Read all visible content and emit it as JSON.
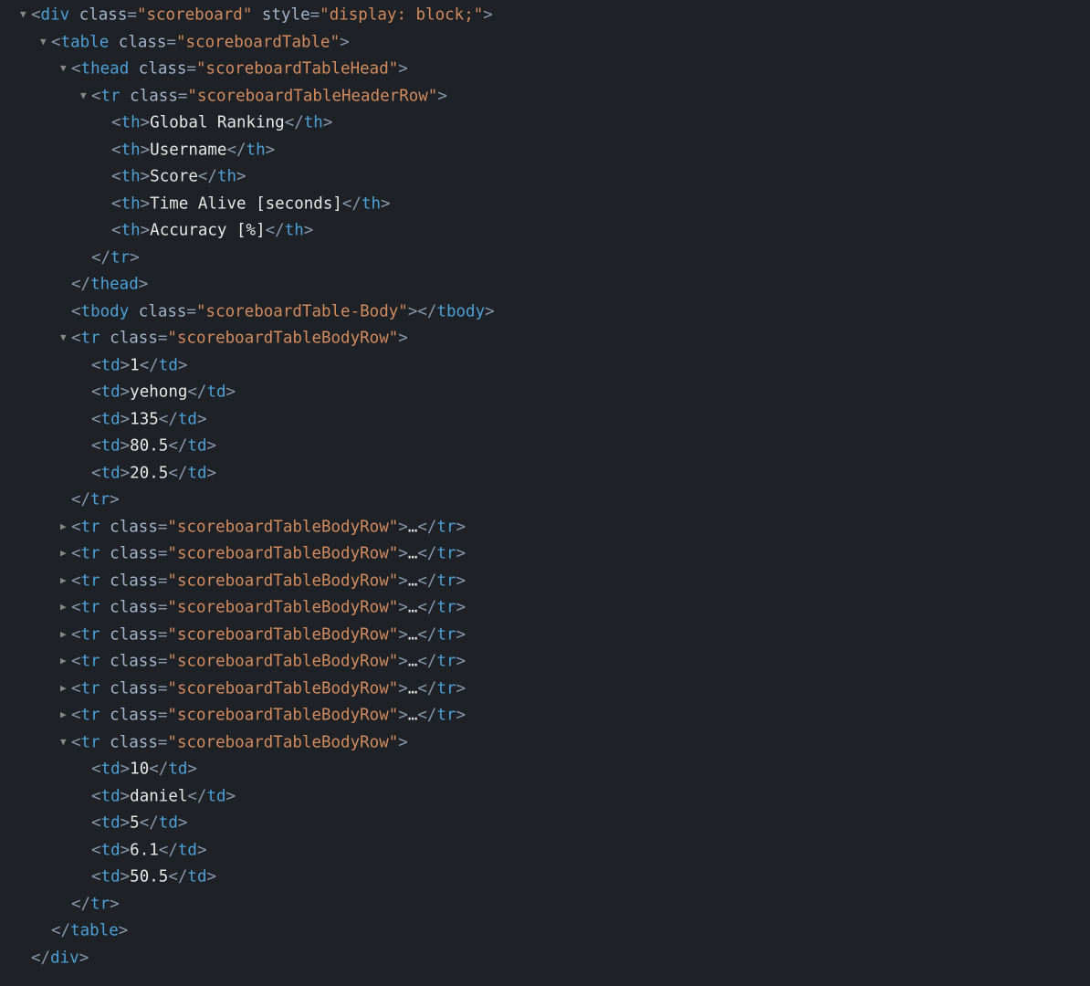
{
  "root": {
    "tag": "div",
    "cls": "scoreboard",
    "style_attr": "style",
    "style_val": "display: block;"
  },
  "table": {
    "tag": "table",
    "cls": "scoreboardTable"
  },
  "thead": {
    "tag": "thead",
    "cls": "scoreboardTableHead"
  },
  "header_row": {
    "tag": "tr",
    "cls": "scoreboardTableHeaderRow"
  },
  "th_tag": "th",
  "headers": [
    "Global Ranking",
    "Username",
    "Score",
    "Time Alive [seconds]",
    "Accuracy [%]"
  ],
  "tbody": {
    "tag": "tbody",
    "cls": "scoreboardTable-Body"
  },
  "body_row_tag": "tr",
  "body_row_cls": "scoreboardTableBodyRow",
  "td_tag": "td",
  "row_first": [
    "1",
    "yehong",
    "135",
    "80.5",
    "20.5"
  ],
  "row_last": [
    "10",
    "daniel",
    "5",
    "6.1",
    "50.5"
  ],
  "collapsed_count": 8,
  "ellipsis": "…",
  "cls_attr": "class"
}
